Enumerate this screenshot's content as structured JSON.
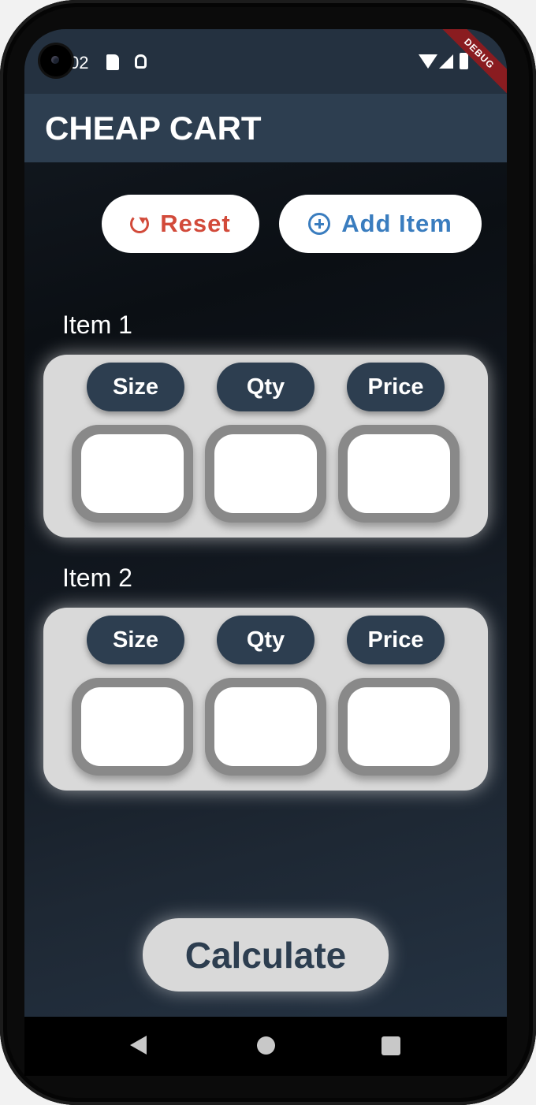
{
  "status_bar": {
    "time": "02",
    "debug_banner": "DEBUG"
  },
  "app_bar": {
    "title": "CHEAP CART"
  },
  "actions": {
    "reset_label": "Reset",
    "add_item_label": "Add Item"
  },
  "items": [
    {
      "label": "Item 1",
      "columns": [
        "Size",
        "Qty",
        "Price"
      ],
      "values": [
        "",
        "",
        ""
      ]
    },
    {
      "label": "Item 2",
      "columns": [
        "Size",
        "Qty",
        "Price"
      ],
      "values": [
        "",
        "",
        ""
      ]
    }
  ],
  "calculate_label": "Calculate",
  "icons": {
    "reset": "refresh-icon",
    "add": "add-circle-icon",
    "nav": [
      "back-icon",
      "home-icon",
      "recents-icon"
    ]
  },
  "colors": {
    "appbar": "#2d3e50",
    "reset": "#d24a3a",
    "add": "#3a7dbf",
    "card": "#d9d9d9"
  }
}
